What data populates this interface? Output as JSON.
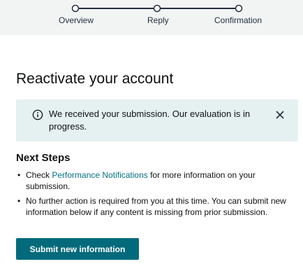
{
  "stepper": {
    "steps": [
      {
        "label": "Overview",
        "state": "complete"
      },
      {
        "label": "Reply",
        "state": "complete"
      },
      {
        "label": "Confirmation",
        "state": "current"
      }
    ]
  },
  "page": {
    "title": "Reactivate your account"
  },
  "alert": {
    "icon": "info-icon",
    "message": "We received your submission. Our evaluation is in progress.",
    "close_icon": "close-icon"
  },
  "next_steps": {
    "heading": "Next Steps",
    "items": [
      {
        "prefix": "Check ",
        "link_text": "Performance Notifications",
        "suffix": " for more information on your submission."
      },
      {
        "text": "No further action is required from you at this time. You can submit new information below if any content is missing from prior submission."
      }
    ]
  },
  "actions": {
    "submit_label": "Submit new information"
  },
  "colors": {
    "stepper_band": "#f2f4f4",
    "stepper_line": "#232f3e",
    "alert_background": "#e5f0f1",
    "link": "#007185",
    "primary_button": "#036a7c"
  }
}
